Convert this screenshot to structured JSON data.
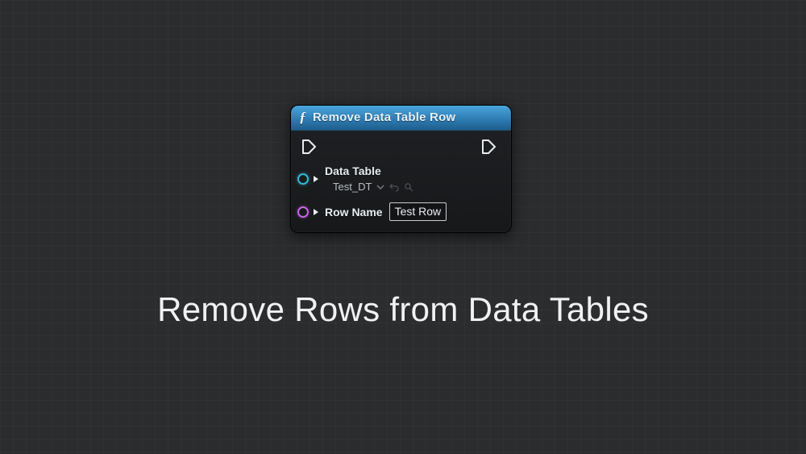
{
  "node": {
    "title": "Remove Data Table Row",
    "pins": {
      "data_table": {
        "label": "Data Table",
        "value": "Test_DT"
      },
      "row_name": {
        "label": "Row Name",
        "value": "Test Row"
      }
    }
  },
  "caption": "Remove Rows from Data Tables"
}
